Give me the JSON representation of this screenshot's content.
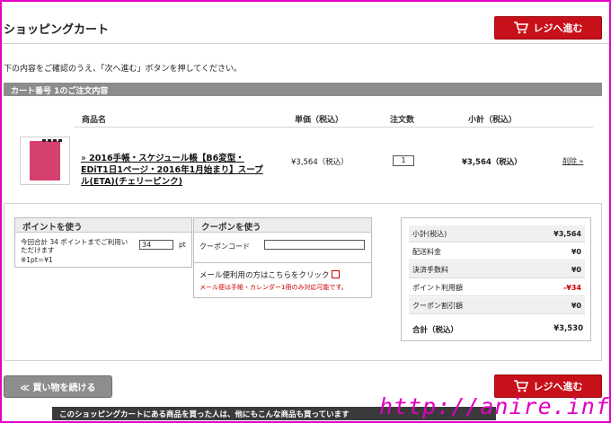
{
  "page_title": "ショッピングカート",
  "checkout_label": "レジへ進む",
  "instruction": "下の内容をご確認のうえ、「次へ進む」ボタンを押してください。",
  "cart_header": "カート番号 1のご注文内容",
  "table_headers": {
    "product": "商品名",
    "unit_price": "単価（税込）",
    "quantity": "注文数",
    "subtotal": "小計（税込）"
  },
  "item": {
    "chevron": "»",
    "name": "2016手帳・スケジュール帳【B6変型・EDiT1日1ページ・2016年1月始まり】スープル(ETA)(チェリーピンク)",
    "unit_price": "¥3,564（税込）",
    "quantity": "1",
    "subtotal": "¥3,564（税込）",
    "delete_label": "削除 »"
  },
  "points": {
    "title": "ポイントを使う",
    "description": "今回合計 34 ポイントまでご利用いただけます",
    "rate": "※1pt＝¥1",
    "input_value": "34",
    "unit": "pt"
  },
  "coupon": {
    "title": "クーポンを使う",
    "code_label": "クーポンコード",
    "mail_option": "メール便利用の方はこちらをクリック",
    "mail_note": "メール便は手帳・カレンダー1冊のみ対応可能です。"
  },
  "summary": {
    "rows": [
      {
        "label": "小計(税込)",
        "value": "¥3,564"
      },
      {
        "label": "配送料金",
        "value": "¥0"
      },
      {
        "label": "決済手数料",
        "value": "¥0"
      },
      {
        "label": "ポイント利用額",
        "value": "-¥34"
      },
      {
        "label": "クーポン割引額",
        "value": "¥0"
      }
    ],
    "total_label": "合計（税込）",
    "total_value": "¥3,530"
  },
  "continue_shopping": "≪ 買い物を続ける",
  "recommendation": "このショッピングカートにある商品を買った人は、他にもこんな商品も買っています",
  "watermark": "http://anire.info/",
  "colors": {
    "accent_red": "#c8101a",
    "discount_red": "#cc0000",
    "header_gray": "#8c8c8c",
    "frame_magenta": "#e600c8"
  }
}
